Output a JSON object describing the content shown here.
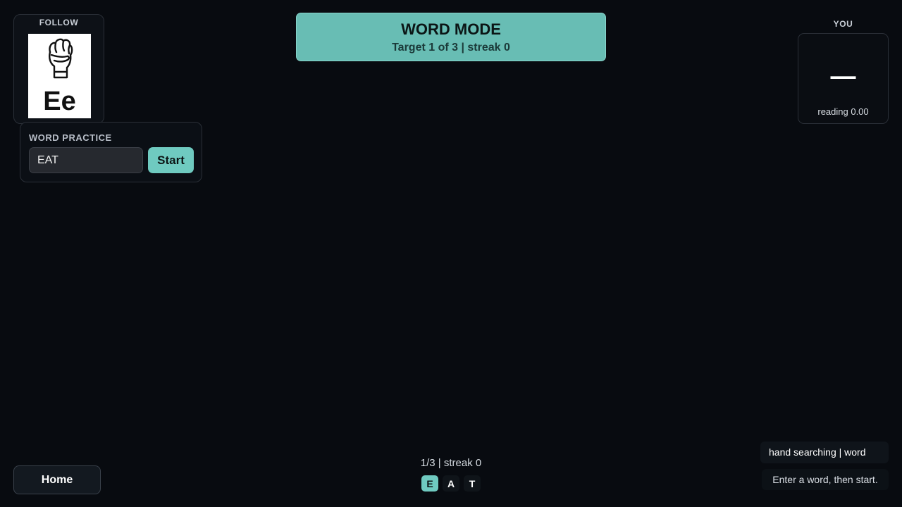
{
  "follow": {
    "label": "FOLLOW",
    "sign_icon": "fist-hand-sign-icon",
    "letter": "Ee"
  },
  "practice": {
    "title": "WORD PRACTICE",
    "input_value": "EAT",
    "start_label": "Start"
  },
  "banner": {
    "title": "WORD MODE",
    "subtitle": "Target 1 of 3 | streak 0"
  },
  "you": {
    "label": "YOU",
    "value": "—",
    "reading": "reading 0.00"
  },
  "footer": {
    "home_label": "Home",
    "progress": "1/3 | streak 0",
    "letters": [
      "E",
      "A",
      "T"
    ],
    "active_letter_index": 0,
    "status": "hand searching | word",
    "hint": "Enter a word, then start."
  },
  "colors": {
    "background": "#080b10",
    "accent": "#6fcac0",
    "banner": "#68bdb4"
  }
}
